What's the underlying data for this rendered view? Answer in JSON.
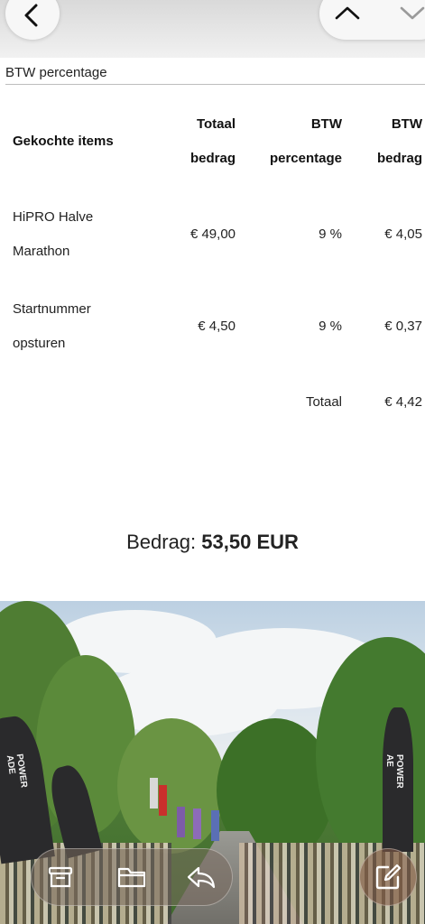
{
  "header": {
    "subject": "BTW percentage"
  },
  "table": {
    "headers": {
      "items": "Gekochte items",
      "total_line1": "Totaal",
      "total_line2": "bedrag",
      "vat_pct_line1": "BTW",
      "vat_pct_line2": "percentage",
      "vat_amt_line1": "BTW",
      "vat_amt_line2": "bedrag"
    },
    "rows": [
      {
        "item_line1": "HiPRO Halve",
        "item_line2": "Marathon",
        "total": "€ 49,00",
        "vat_pct": "9 %",
        "vat_amt": "€ 4,05"
      },
      {
        "item_line1": "Startnummer",
        "item_line2": "opsturen",
        "total": "€ 4,50",
        "vat_pct": "9 %",
        "vat_amt": "€ 0,37"
      }
    ],
    "footer": {
      "label": "Totaal",
      "value": "€ 4,42"
    }
  },
  "amount": {
    "label": "Bedrag:",
    "value": "53,50 EUR"
  },
  "photo": {
    "flag_text_left": "POWER ADE",
    "flag_text_right": "POWER AE"
  },
  "toolbar": {
    "icons": [
      "archive-icon",
      "folder-icon",
      "reply-icon"
    ],
    "compose_icon": "compose-icon"
  },
  "colors": {
    "text": "#222222",
    "divider": "#bdbdbd"
  }
}
